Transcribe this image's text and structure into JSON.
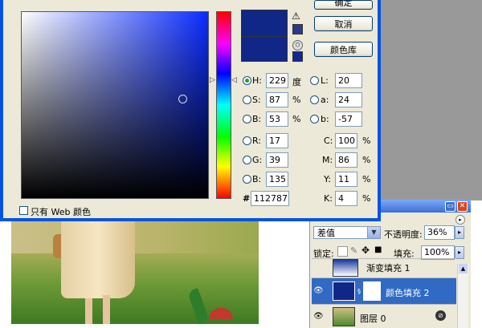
{
  "photo_alt": "",
  "color_picker": {
    "buttons": {
      "ok": "确定",
      "cancel": "取消",
      "color_library": "颜色库"
    },
    "colors": {
      "new": "#112787",
      "current": "#112787",
      "web_safe_alt": "#14288f"
    },
    "hsb": {
      "h": {
        "label": "H:",
        "value": "229",
        "unit": "度"
      },
      "s": {
        "label": "S:",
        "value": "87",
        "unit": "%"
      },
      "b": {
        "label": "B:",
        "value": "53",
        "unit": "%"
      }
    },
    "rgb": {
      "r": {
        "label": "R:",
        "value": "17"
      },
      "g": {
        "label": "G:",
        "value": "39"
      },
      "b": {
        "label": "B:",
        "value": "135"
      }
    },
    "lab": {
      "l": {
        "label": "L:",
        "value": "20"
      },
      "a": {
        "label": "a:",
        "value": "24"
      },
      "b": {
        "label": "b:",
        "value": "-57"
      }
    },
    "cmyk": {
      "c": {
        "label": "C:",
        "value": "100",
        "unit": "%"
      },
      "m": {
        "label": "M:",
        "value": "86",
        "unit": "%"
      },
      "y": {
        "label": "Y:",
        "value": "11",
        "unit": "%"
      },
      "k": {
        "label": "K:",
        "value": "4",
        "unit": "%"
      }
    },
    "hex": {
      "label": "#",
      "value": "112787"
    },
    "web_only": {
      "label": "只有 Web 颜色",
      "checked": false
    },
    "selected_mode": "H"
  },
  "layers_panel": {
    "blend_mode": "差值",
    "opacity": {
      "label": "不透明度:",
      "value": "36%"
    },
    "lock_label": "锁定:",
    "fill": {
      "label": "填充:",
      "value": "100%"
    },
    "layers": [
      {
        "name": "渐变填充 1",
        "visible": false,
        "selected": false
      },
      {
        "name": "颜色填充 2",
        "visible": true,
        "selected": true
      },
      {
        "name": "图层 0",
        "visible": true,
        "selected": false
      }
    ]
  }
}
